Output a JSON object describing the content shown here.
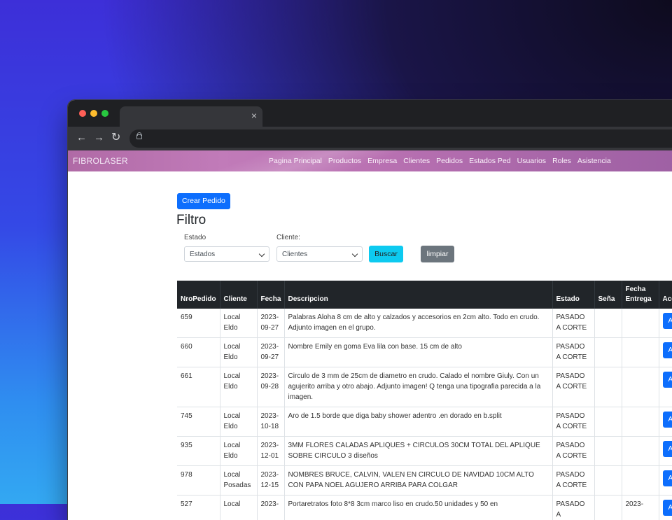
{
  "browser": {
    "tab_close": "×",
    "back": "←",
    "forward": "→",
    "reload": "↻"
  },
  "navbar": {
    "brand": "FIBROLASER",
    "links": [
      "Pagina Principal",
      "Productos",
      "Empresa",
      "Clientes",
      "Pedidos",
      "Estados Ped",
      "Usuarios",
      "Roles",
      "Asistencia"
    ]
  },
  "page": {
    "create_button": "Crear Pedido",
    "filter_title": "Filtro",
    "estado_label": "Estado",
    "estado_value": "Estados",
    "cliente_label": "Cliente:",
    "cliente_value": "Clientes",
    "search_button": "Buscar",
    "clear_button": "limpiar"
  },
  "table": {
    "headers": [
      "NroPedido",
      "Cliente",
      "Fecha",
      "Descripcion",
      "Estado",
      "Seña",
      "Fecha Entrega",
      "Acciones"
    ],
    "action_label": "Ac",
    "rows": [
      {
        "nro": "659",
        "cliente": "Local Eldo",
        "fecha": "2023-09-27",
        "descripcion": "Palabras Aloha 8 cm de alto y calzados y accesorios en 2cm alto. Todo en crudo. Adjunto imagen en el grupo.",
        "estado": "PASADO A CORTE",
        "sena": "",
        "entrega": ""
      },
      {
        "nro": "660",
        "cliente": "Local Eldo",
        "fecha": "2023-09-27",
        "descripcion": "Nombre Emily en goma Eva lila con base. 15 cm de alto",
        "estado": "PASADO A CORTE",
        "sena": "",
        "entrega": ""
      },
      {
        "nro": "661",
        "cliente": "Local Eldo",
        "fecha": "2023-09-28",
        "descripcion": "Circulo de 3 mm de 25cm de diametro en crudo. Calado el nombre Giuly. Con un agujerito arriba y otro abajo. Adjunto imagen! Q tenga una tipografia parecida a la imagen.",
        "estado": "PASADO A CORTE",
        "sena": "",
        "entrega": ""
      },
      {
        "nro": "745",
        "cliente": "Local Eldo",
        "fecha": "2023-10-18",
        "descripcion": "Aro de 1.5 borde que diga baby shower adentro .en dorado en b.split",
        "estado": "PASADO A CORTE",
        "sena": "",
        "entrega": ""
      },
      {
        "nro": "935",
        "cliente": "Local Eldo",
        "fecha": "2023-12-01",
        "descripcion": "3MM FLORES CALADAS APLIQUES + CIRCULOS 30CM TOTAL DEL APLIQUE SOBRE CIRCULO 3 diseños",
        "estado": "PASADO A CORTE",
        "sena": "",
        "entrega": ""
      },
      {
        "nro": "978",
        "cliente": "Local Posadas",
        "fecha": "2023-12-15",
        "descripcion": "NOMBRES BRUCE, CALVIN, VALEN EN CIRCULO DE NAVIDAD 10CM ALTO CON PAPA NOEL AGUJERO ARRIBA PARA COLGAR",
        "estado": "PASADO A CORTE",
        "sena": "",
        "entrega": ""
      },
      {
        "nro": "527",
        "cliente": "Local",
        "fecha": "2023-",
        "descripcion": "Portaretratos foto 8*8 3cm marco liso en crudo.50 unidades y 50 en",
        "estado": "PASADO A",
        "sena": "",
        "entrega": "2023-"
      }
    ]
  }
}
